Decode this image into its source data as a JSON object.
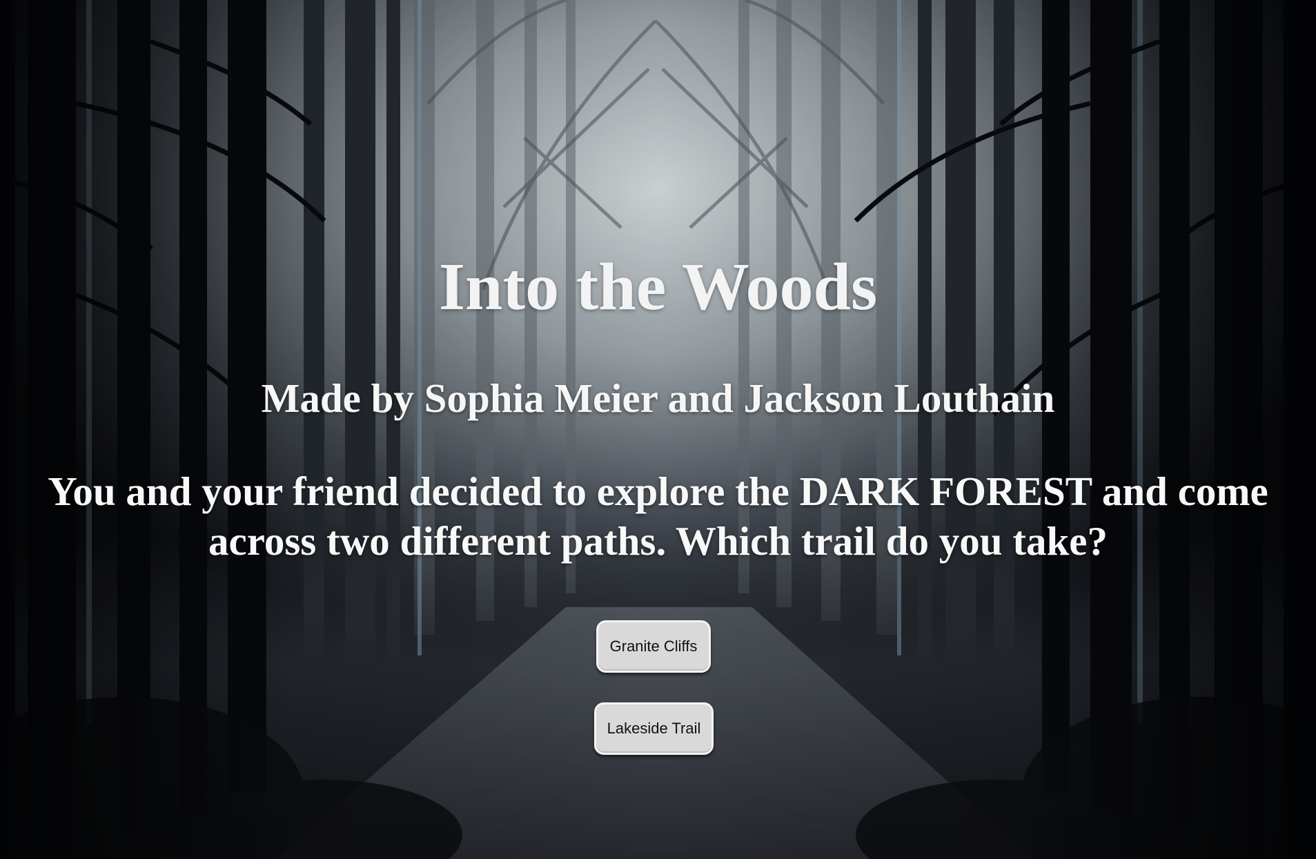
{
  "page": {
    "title": "Into the Woods",
    "byline": "Made by Sophia Meier and Jackson Louthain",
    "story": "You and your friend decided to explore the DARK FOREST and come across two different paths. Which trail do you take?"
  },
  "choices": [
    {
      "label": "Granite Cliffs"
    },
    {
      "label": "Lakeside Trail"
    }
  ],
  "background": {
    "scene": "dark misty forest with bare trees and a path",
    "colors": {
      "sky_glow": "#cfd6da",
      "mist": "#8a949c",
      "trunk_dark": "#0b0d12",
      "ground": "#23262d"
    }
  }
}
